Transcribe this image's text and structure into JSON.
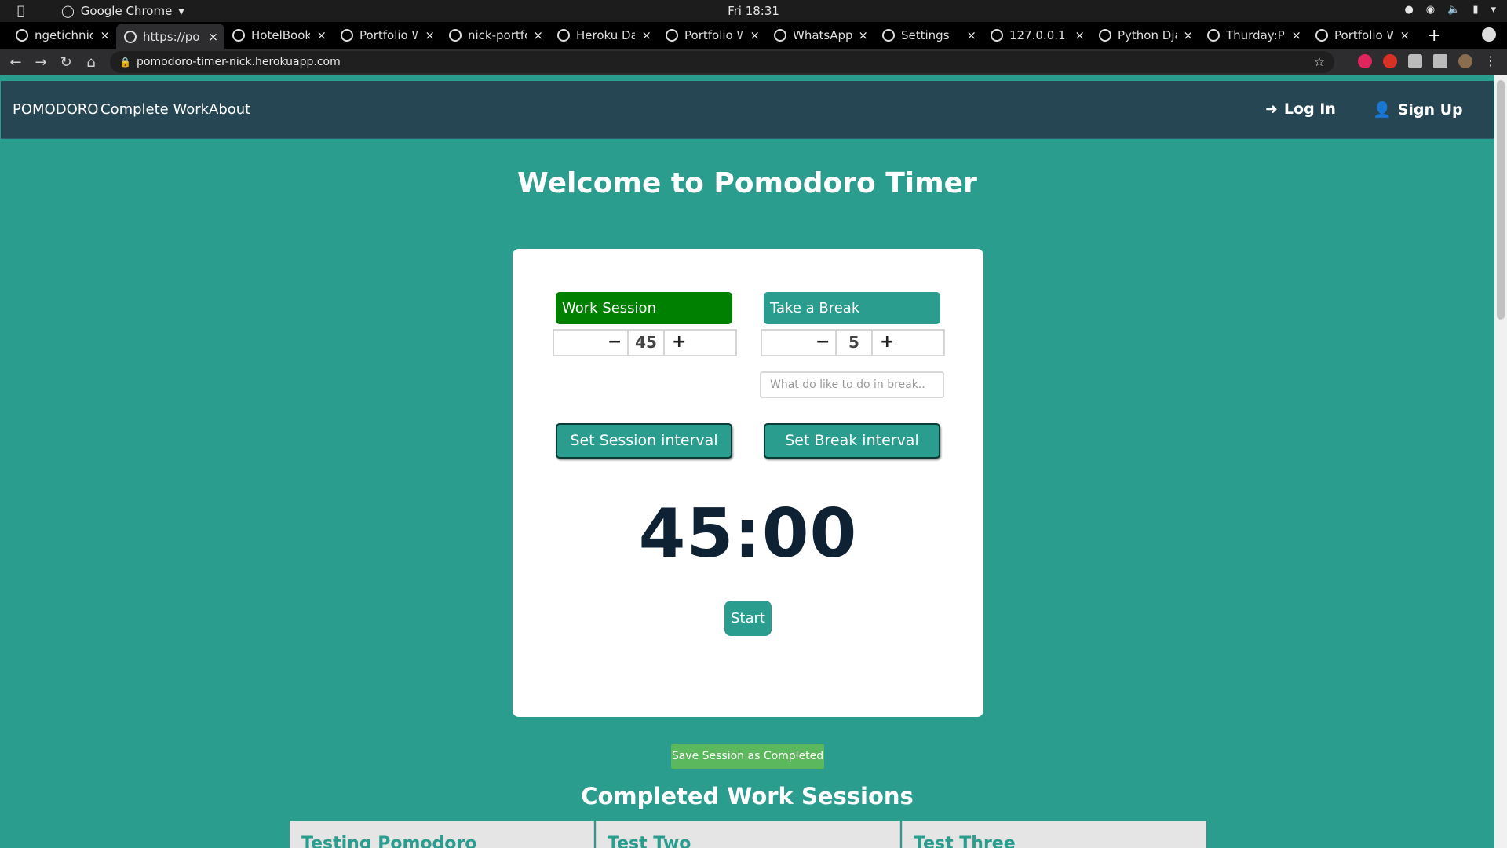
{
  "os": {
    "app_name": "Google Chrome",
    "clock": "Fri 18:31"
  },
  "browser": {
    "tabs": [
      {
        "title": "ngetichnic",
        "icon": "github-icon",
        "active": false
      },
      {
        "title": "https://po",
        "icon": "globe-icon",
        "active": true
      },
      {
        "title": "HotelBook",
        "icon": "a-icon",
        "active": false
      },
      {
        "title": "Portfolio W",
        "icon": "globe-icon",
        "active": false
      },
      {
        "title": "nick-portfo",
        "icon": "heroku-icon",
        "active": false
      },
      {
        "title": "Heroku Da",
        "icon": "heroku-icon",
        "active": false
      },
      {
        "title": "Portfolio W",
        "icon": "globe-icon",
        "active": false
      },
      {
        "title": "WhatsApp",
        "icon": "whatsapp-icon",
        "active": false
      },
      {
        "title": "Settings",
        "icon": "gear-icon",
        "active": false
      },
      {
        "title": "127.0.0.1",
        "icon": "globe-icon",
        "active": false
      },
      {
        "title": "Python Dja",
        "icon": "youtube-icon",
        "active": false
      },
      {
        "title": "Thurday:P",
        "icon": "loading-icon",
        "active": false
      },
      {
        "title": "Portfolio W",
        "icon": "globe-icon",
        "active": false
      }
    ],
    "url": "pomodoro-timer-nick.herokuapp.com"
  },
  "navbar": {
    "brand": "POMODORO",
    "links": [
      "Complete Work",
      "About"
    ],
    "login": "Log In",
    "signup": "Sign Up"
  },
  "main": {
    "welcome": "Welcome to Pomodoro Timer",
    "work": {
      "label": "Work Session",
      "minus": "−",
      "plus": "+",
      "value": "45",
      "set_label": "Set Session interval"
    },
    "break": {
      "label": "Take a Break",
      "minus": "−",
      "plus": "+",
      "value": "5",
      "placeholder": "What do like to do in break..",
      "set_label": "Set Break interval"
    },
    "timer": "45:00",
    "start": "Start",
    "save": "Save Session as Completed",
    "completed_title": "Completed Work Sessions",
    "sessions": [
      "Testing Pomodoro",
      "Test Two",
      "Test Three"
    ]
  },
  "colors": {
    "page_bg": "#2a9d8f",
    "navbar_bg": "#264653",
    "work_active": "#008000",
    "save_green": "#5cb85c",
    "timer_text": "#0f2233"
  }
}
